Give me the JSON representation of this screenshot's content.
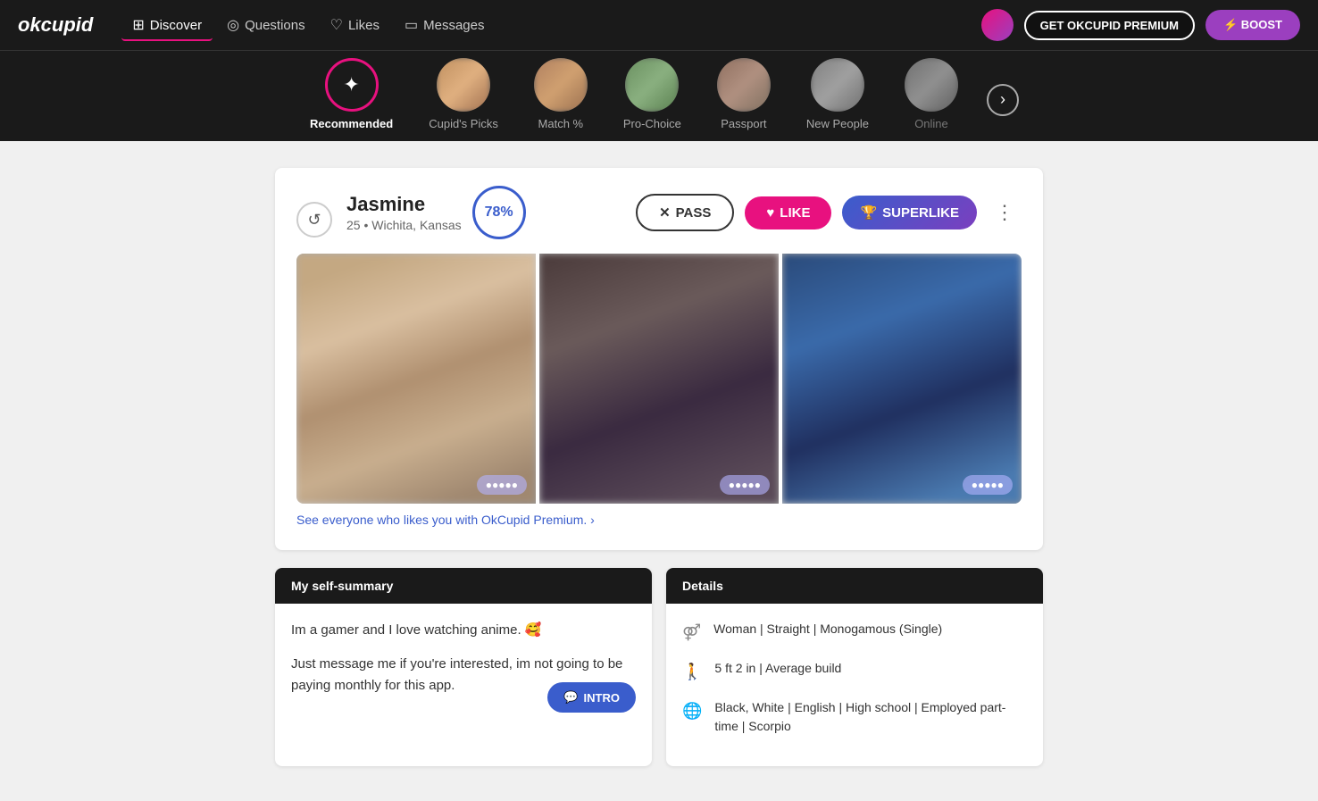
{
  "logo": "okcupid",
  "nav": {
    "items": [
      {
        "id": "discover",
        "label": "Discover",
        "icon": "⊞",
        "active": true
      },
      {
        "id": "questions",
        "label": "Questions",
        "icon": "◎"
      },
      {
        "id": "likes",
        "label": "Likes",
        "icon": "♡"
      },
      {
        "id": "messages",
        "label": "Messages",
        "icon": "▭"
      }
    ]
  },
  "header_buttons": {
    "premium": "GET OKCUPID PREMIUM",
    "boost": "⚡ BOOST"
  },
  "categories": [
    {
      "id": "recommended",
      "label": "Recommended",
      "active": true,
      "icon": "heart"
    },
    {
      "id": "cupids-picks",
      "label": "Cupid's Picks",
      "active": false
    },
    {
      "id": "match",
      "label": "Match %",
      "active": false
    },
    {
      "id": "pro-choice",
      "label": "Pro-Choice",
      "active": false
    },
    {
      "id": "passport",
      "label": "Passport",
      "active": false
    },
    {
      "id": "new-people",
      "label": "New People",
      "active": false
    },
    {
      "id": "online",
      "label": "Online",
      "active": false
    }
  ],
  "profile": {
    "name": "Jasmine",
    "age": "25",
    "location": "Wichita, Kansas",
    "match_percent": "78%",
    "photos": [
      {
        "tag": "blurred1"
      },
      {
        "tag": "blurred2"
      },
      {
        "tag": "blurred3"
      }
    ],
    "premium_teaser": "See everyone who likes you with OkCupid Premium. ›",
    "actions": {
      "pass": "PASS",
      "like": "LIKE",
      "superlike": "SUPERLIKE"
    }
  },
  "self_summary": {
    "header": "My self-summary",
    "text1": "Im a gamer and I love watching anime. 🥰",
    "text2": "Just message me if you're interested, im not going to be paying monthly for this app.",
    "intro_btn": "INTRO",
    "intro_icon": "💬"
  },
  "details": {
    "header": "Details",
    "rows": [
      {
        "icon": "⚤",
        "text": "Woman | Straight | Monogamous (Single)"
      },
      {
        "icon": "🚶",
        "text": "5 ft 2 in | Average build"
      },
      {
        "icon": "🌐",
        "text": "Black, White | English | High school | Employed part-time | Scorpio"
      }
    ]
  }
}
